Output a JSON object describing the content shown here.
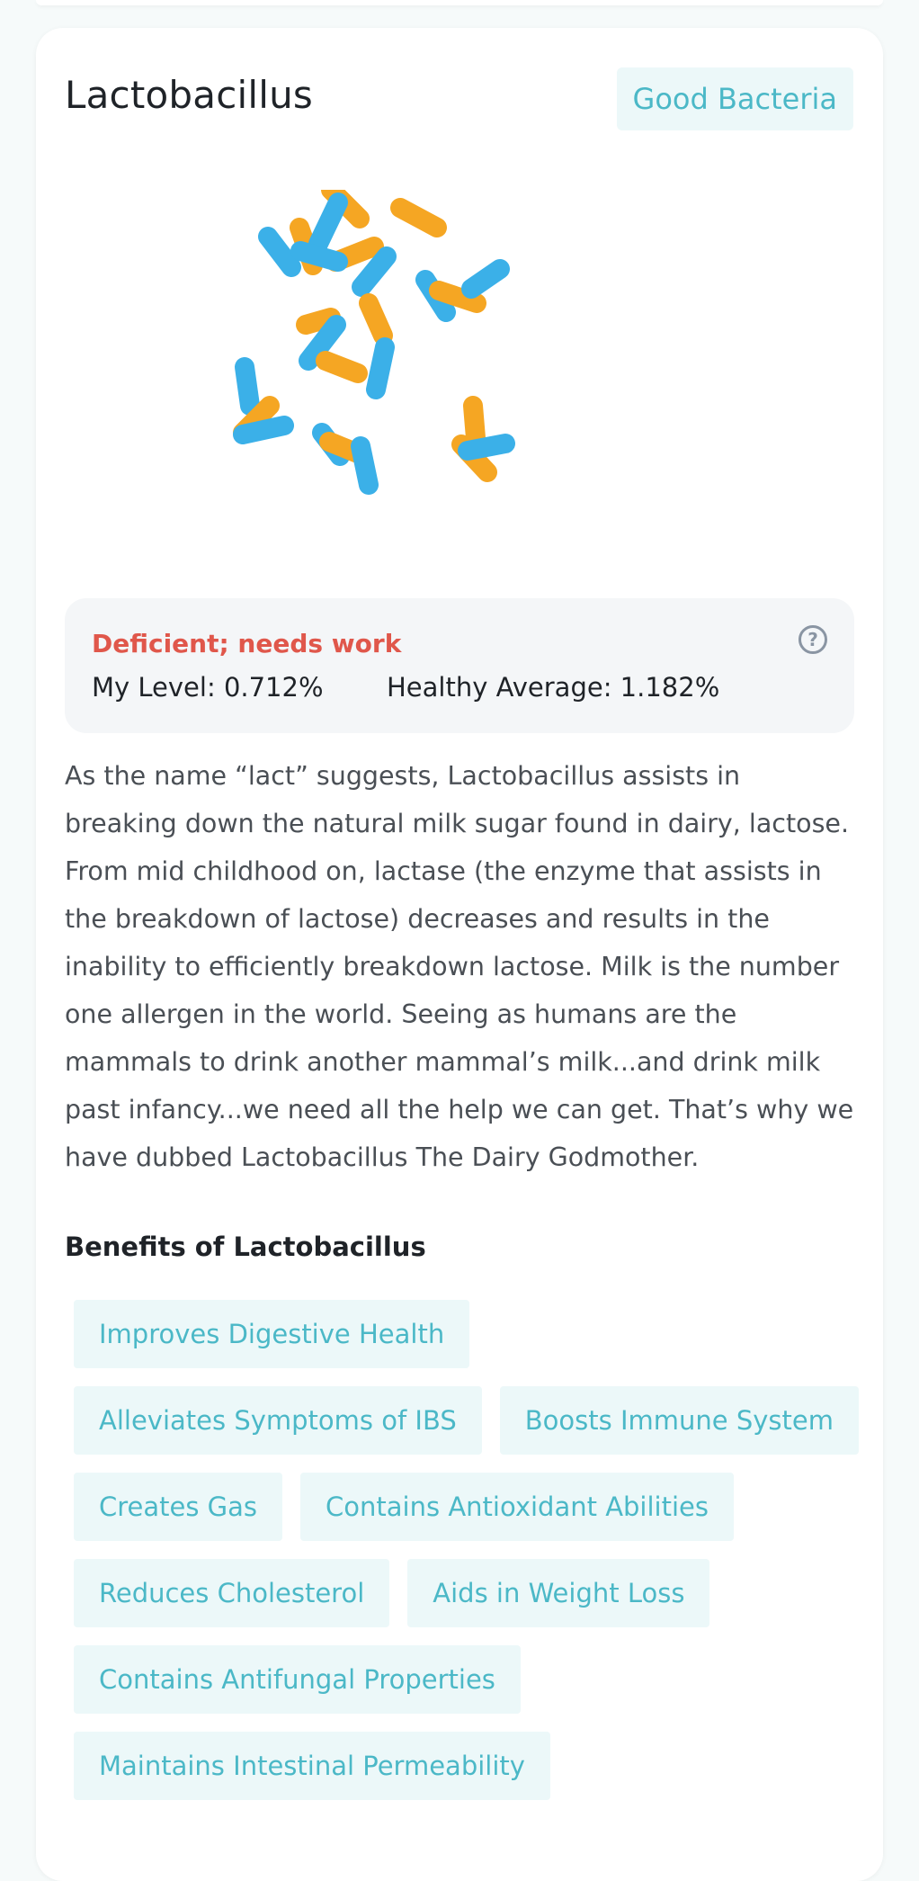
{
  "card": {
    "title": "Lactobacillus",
    "badge": "Good Bacteria",
    "illustration": "bacteria-rods-illustration",
    "colors": {
      "orange": "#f5a623",
      "blue": "#3bb0e8",
      "accent": "#4bb8c7",
      "status": "#e0574b"
    }
  },
  "level": {
    "status": "Deficient; needs work",
    "my_level": "My Level: 0.712%",
    "healthy_average": "Healthy Average: 1.182%",
    "help_icon": "?"
  },
  "description": "As the name “lact” suggests, Lactobacillus assists in breaking down the natural milk sugar found in dairy, lactose. From mid childhood on, lactase (the enzyme that assists in the breakdown of lactose) decreases and results in the inability to efficiently breakdown lactose. Milk is the number one allergen in the world. Seeing as humans are the mammals to drink another mammal’s milk...and drink milk past infancy...we need all the help we can get. That’s why we have dubbed Lactobacillus The Dairy Godmother.",
  "benefits": {
    "title": "Benefits of Lactobacillus",
    "items": [
      "Improves Digestive Health",
      "Alleviates Symptoms of IBS",
      "Boosts Immune System",
      "Creates Gas",
      "Contains Antioxidant Abilities",
      "Reduces Cholesterol",
      "Aids in Weight Loss",
      "Contains Antifungal Properties",
      "Maintains Intestinal Permeability"
    ]
  }
}
